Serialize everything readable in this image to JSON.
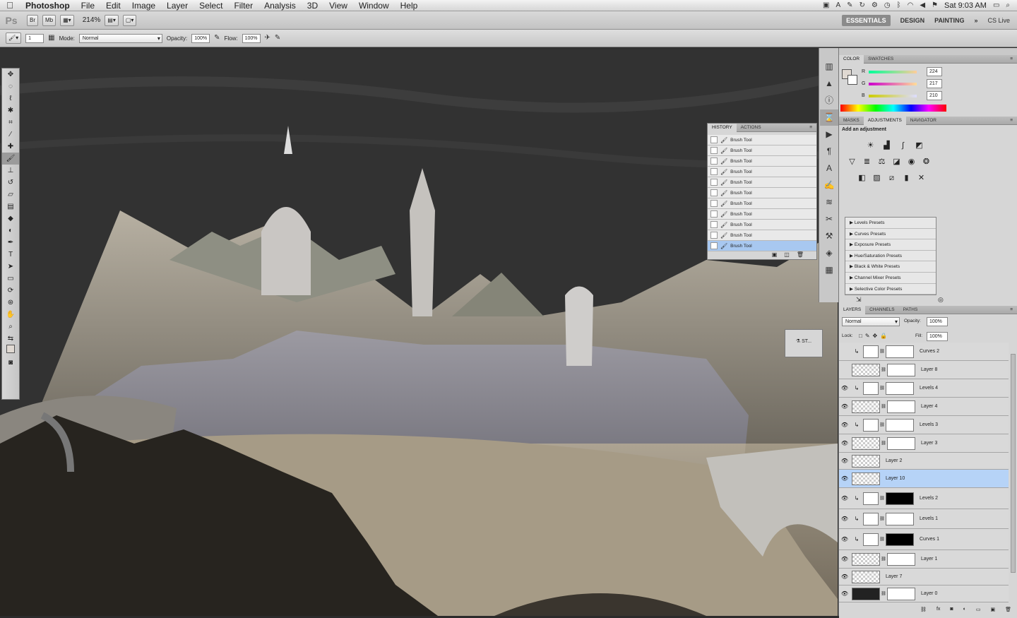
{
  "menubar": {
    "app": "Photoshop",
    "items": [
      "File",
      "Edit",
      "Image",
      "Layer",
      "Select",
      "Filter",
      "Analysis",
      "3D",
      "View",
      "Window",
      "Help"
    ],
    "clock": "Sat 9:03 AM"
  },
  "appbar": {
    "logo": "Ps",
    "br": "Br",
    "mb": "Mb",
    "zoom": "214%",
    "workspaces": [
      "ESSENTIALS",
      "DESIGN",
      "PAINTING"
    ],
    "more": "»",
    "cslive": "CS Live"
  },
  "options": {
    "brush_size": "1",
    "mode_label": "Mode:",
    "mode": "Normal",
    "opacity_label": "Opacity:",
    "opacity": "100%",
    "flow_label": "Flow:",
    "flow": "100%"
  },
  "history": {
    "tabs": [
      "HISTORY",
      "ACTIONS"
    ],
    "items": [
      "Brush Tool",
      "Brush Tool",
      "Brush Tool",
      "Brush Tool",
      "Brush Tool",
      "Brush Tool",
      "Brush Tool",
      "Brush Tool",
      "Brush Tool",
      "Brush Tool",
      "Brush Tool"
    ]
  },
  "styles_mini": {
    "label": "ST..."
  },
  "color": {
    "tabs": [
      "COLOR",
      "SWATCHES"
    ],
    "r_label": "R",
    "g_label": "G",
    "b_label": "B",
    "r": "224",
    "g": "217",
    "b": "210"
  },
  "adjustments": {
    "tabs": [
      "MASKS",
      "ADJUSTMENTS",
      "NAVIGATOR"
    ],
    "heading": "Add an adjustment",
    "presets": [
      "Levels Presets",
      "Curves Presets",
      "Exposure Presets",
      "Hue/Saturation Presets",
      "Black & White Presets",
      "Channel Mixer Presets",
      "Selective Color Presets"
    ]
  },
  "layers": {
    "tabs": [
      "LAYERS",
      "CHANNELS",
      "PATHS"
    ],
    "blend": "Normal",
    "opacity_label": "Opacity:",
    "opacity": "100%",
    "lock_label": "Lock:",
    "fill_label": "Fill:",
    "fill": "100%",
    "rows": [
      {
        "name": "Curves 2",
        "visible": false
      },
      {
        "name": "Layer 8",
        "visible": false
      },
      {
        "name": "Levels 4",
        "visible": true
      },
      {
        "name": "Layer 4",
        "visible": true
      },
      {
        "name": "Levels 3",
        "visible": true
      },
      {
        "name": "Layer 3",
        "visible": true
      },
      {
        "name": "Layer 2",
        "visible": true
      },
      {
        "name": "Layer 10",
        "visible": true
      },
      {
        "name": "Levels 2",
        "visible": true
      },
      {
        "name": "Levels 1",
        "visible": true
      },
      {
        "name": "Curves 1",
        "visible": true
      },
      {
        "name": "Layer 1",
        "visible": true
      },
      {
        "name": "Layer 7",
        "visible": true
      },
      {
        "name": "Layer 0",
        "visible": true
      }
    ]
  },
  "colors": {
    "selection": "#b6d3f7",
    "panel": "#d6d6d6",
    "canvas_dark": "#333333",
    "sand": "#a99f8c"
  }
}
